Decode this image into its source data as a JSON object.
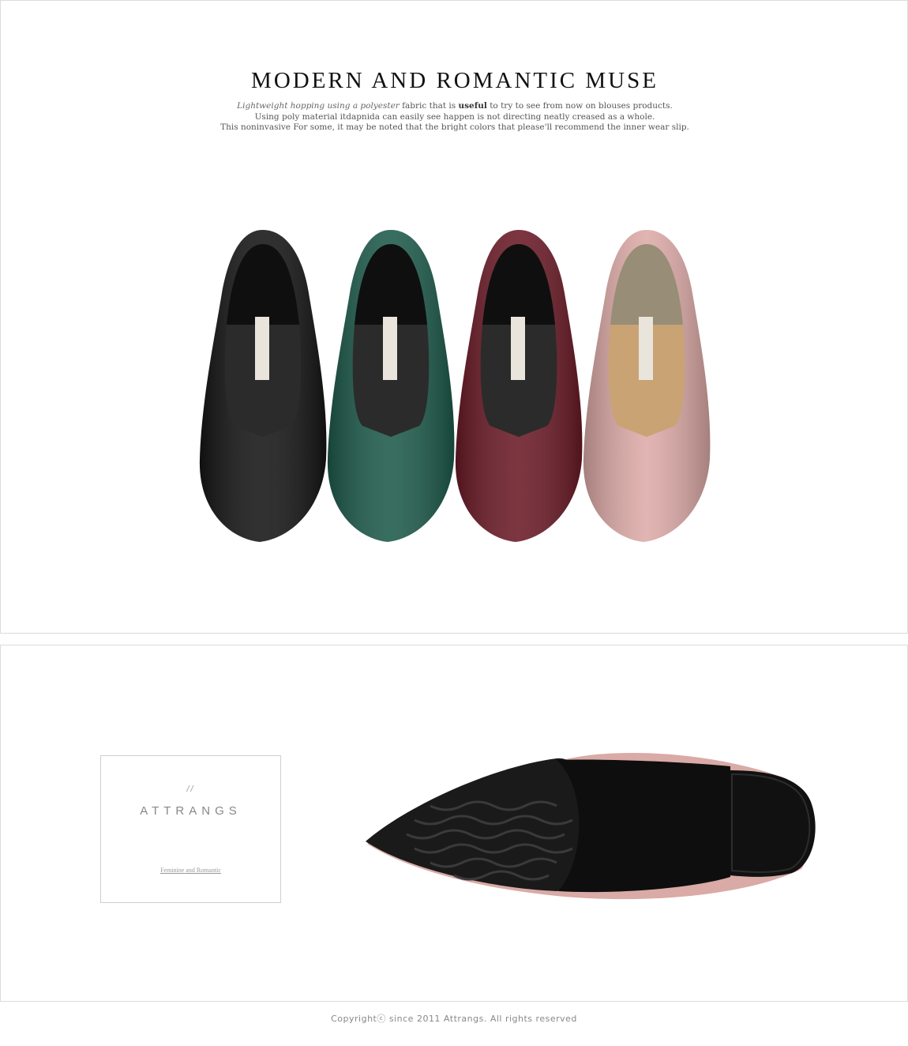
{
  "headline": "MODERN AND ROMANTIC MUSE",
  "description": {
    "line1_italic": "Lightweight hopping using a polyester",
    "line1_mid": " fabric that is ",
    "line1_bold": "useful",
    "line1_end": " to try to see from now on blouses products.",
    "line2": "Using poly material itdapnida can easily see happen is not directing neatly creased as a whole.",
    "line3": "This noninvasive For some, it may be noted that the bright colors that please'll recommend the inner wear slip."
  },
  "shoe_colors": [
    {
      "name": "black",
      "hex": "#151515"
    },
    {
      "name": "green",
      "hex": "#1d5a4a"
    },
    {
      "name": "burgundy",
      "hex": "#6a1a26"
    },
    {
      "name": "pink",
      "hex": "#dcaaa7"
    }
  ],
  "brand": {
    "slashes": "//",
    "name": "ATTRANGS",
    "tagline": "Feminine and Romantic"
  },
  "footer": {
    "copyright": "Copyrightⓒ  since 2011 Attrangs. All rights reserved"
  }
}
